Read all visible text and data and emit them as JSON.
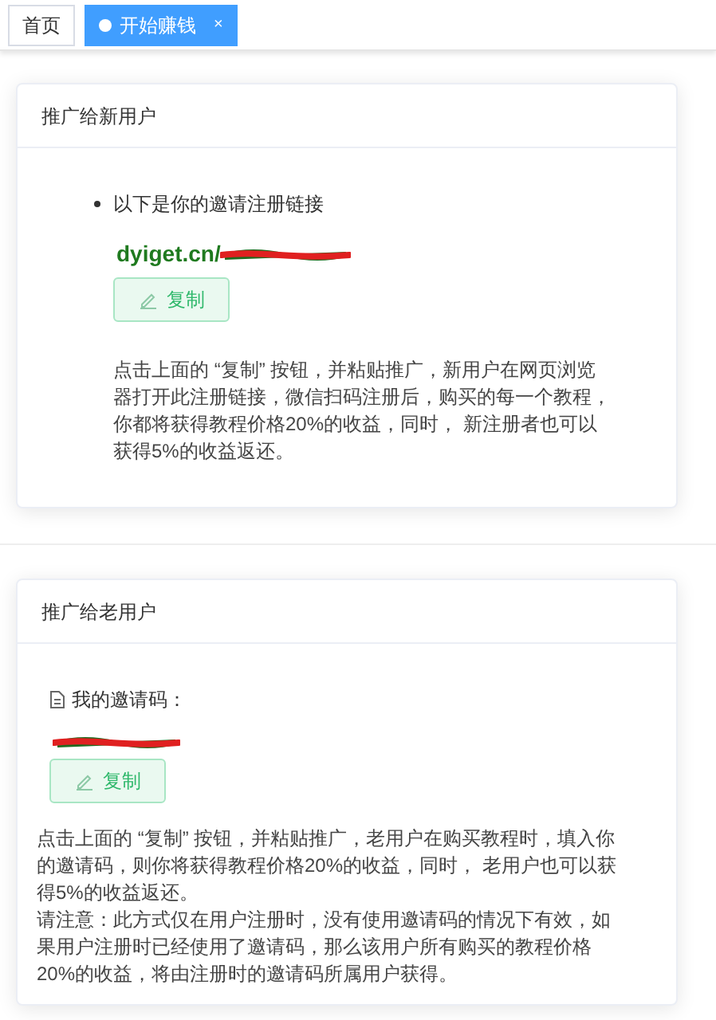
{
  "tabs": [
    {
      "label": "首页",
      "selected": false,
      "closable": false
    },
    {
      "label": "开始赚钱",
      "selected": true,
      "closable": true,
      "close_glyph": "×"
    }
  ],
  "cards": [
    {
      "title": "推广给新用户",
      "kind": "link",
      "intro": "以下是你的邀请注册链接",
      "link_prefix": "dyiget.cn/",
      "copy_button": "复制",
      "paragraphs": [
        "点击上面的 “复制” 按钮，并粘贴推广，新用户在网页浏览器打开此注册链接，微信扫码注册后，购买的每一个教程，你都将获得教程价格20%的收益，同时， 新注册者也可以获得5%的收益返还。"
      ]
    },
    {
      "title": "推广给老用户",
      "kind": "code",
      "intro": "我的邀请码：",
      "copy_button": "复制",
      "paragraphs": [
        "点击上面的 “复制” 按钮，并粘贴推广，老用户在购买教程时，填入你的邀请码，则你将获得教程价格20%的收益，同时， 老用户也可以获得5%的收益返还。",
        "请注意：此方式仅在用户注册时，没有使用邀请码的情况下有效，如果用户注册时已经使用了邀请码，那么该用户所有购买的教程价格20%的收益，将由注册时的邀请码所属用户获得。"
      ]
    }
  ]
}
